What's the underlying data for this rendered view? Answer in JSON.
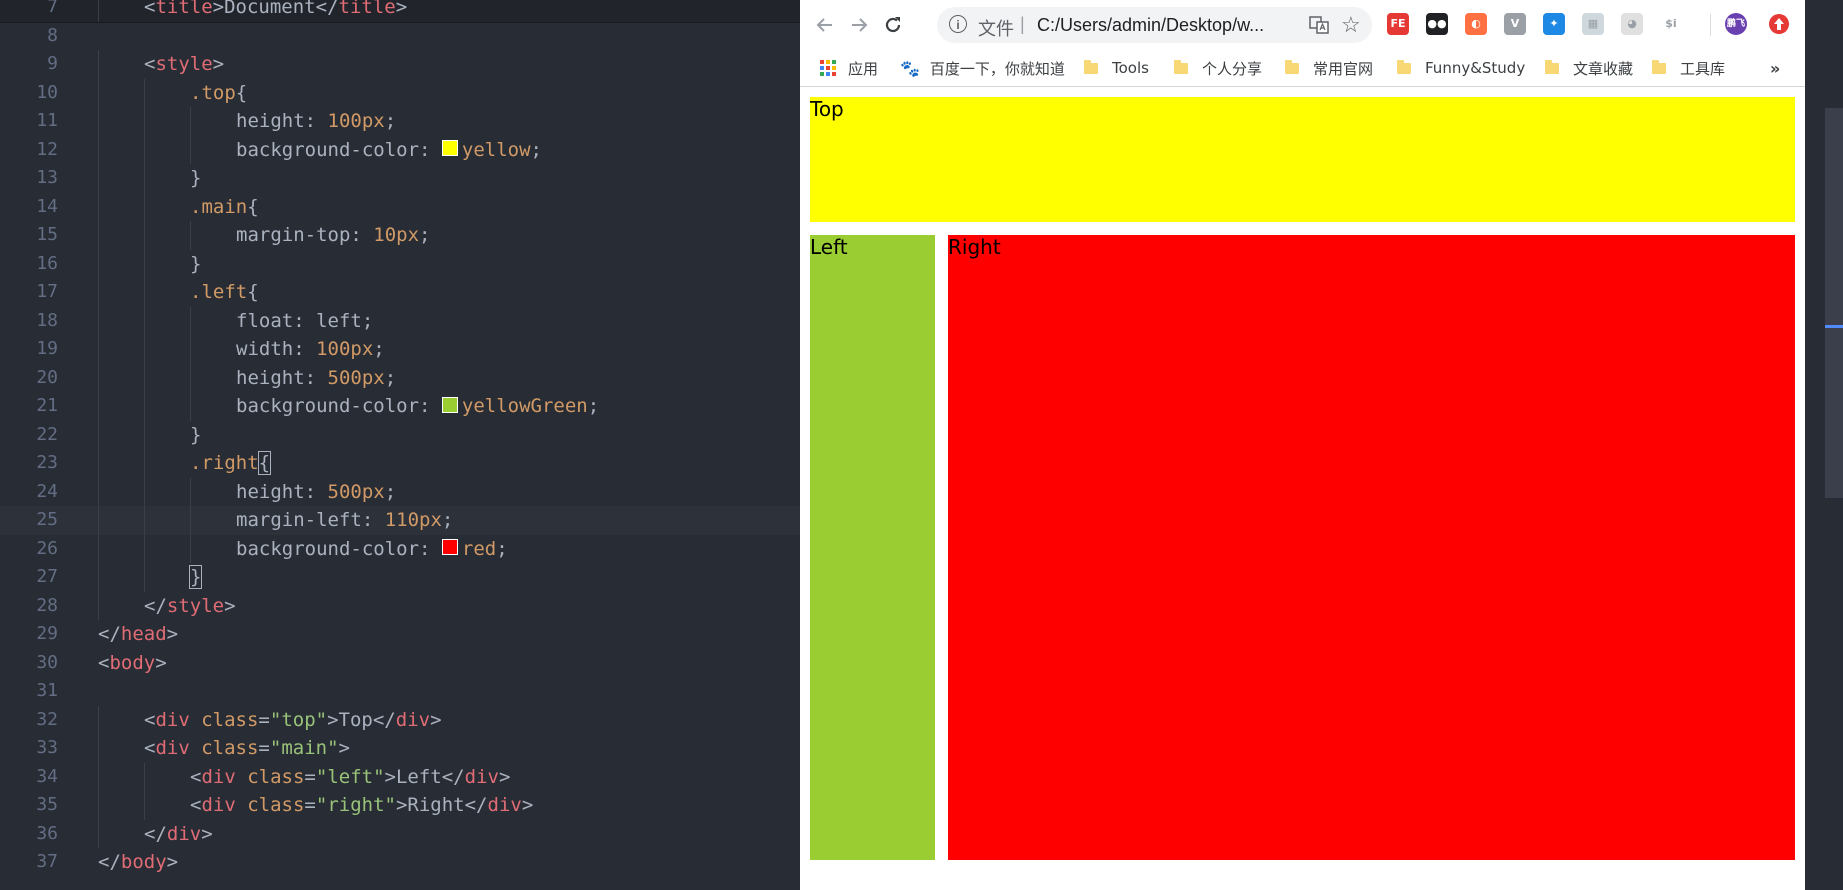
{
  "editor": {
    "lines": [
      {
        "n": "7",
        "indent": 1,
        "tokens": [
          [
            "t-punc",
            "<"
          ],
          [
            "t-tag",
            "title"
          ],
          [
            "t-punc",
            ">"
          ],
          [
            "t-text",
            "Document"
          ],
          [
            "t-punc",
            "</"
          ],
          [
            "t-tag",
            "title"
          ],
          [
            "t-punc",
            ">"
          ]
        ]
      },
      {
        "n": "8",
        "indent": 0,
        "tokens": []
      },
      {
        "n": "9",
        "indent": 1,
        "tokens": [
          [
            "t-punc",
            "<"
          ],
          [
            "t-tag",
            "style"
          ],
          [
            "t-punc",
            ">"
          ]
        ]
      },
      {
        "n": "10",
        "indent": 2,
        "tokens": [
          [
            "t-sel",
            ".top"
          ],
          [
            "t-punc",
            "{"
          ]
        ]
      },
      {
        "n": "11",
        "indent": 3,
        "tokens": [
          [
            "t-prop",
            "height: "
          ],
          [
            "t-num",
            "100px"
          ],
          [
            "t-punc",
            ";"
          ]
        ]
      },
      {
        "n": "12",
        "indent": 3,
        "tokens": [
          [
            "t-prop",
            "background-color: "
          ],
          [
            "swatch",
            "#ffff00"
          ],
          [
            "t-val",
            "yellow"
          ],
          [
            "t-punc",
            ";"
          ]
        ]
      },
      {
        "n": "13",
        "indent": 2,
        "tokens": [
          [
            "t-punc",
            "}"
          ]
        ]
      },
      {
        "n": "14",
        "indent": 2,
        "tokens": [
          [
            "t-sel",
            ".main"
          ],
          [
            "t-punc",
            "{"
          ]
        ]
      },
      {
        "n": "15",
        "indent": 3,
        "tokens": [
          [
            "t-prop",
            "margin-top: "
          ],
          [
            "t-num",
            "10px"
          ],
          [
            "t-punc",
            ";"
          ]
        ]
      },
      {
        "n": "16",
        "indent": 2,
        "tokens": [
          [
            "t-punc",
            "}"
          ]
        ]
      },
      {
        "n": "17",
        "indent": 2,
        "tokens": [
          [
            "t-sel",
            ".left"
          ],
          [
            "t-punc",
            "{"
          ]
        ]
      },
      {
        "n": "18",
        "indent": 3,
        "tokens": [
          [
            "t-prop",
            "float: left;"
          ]
        ]
      },
      {
        "n": "19",
        "indent": 3,
        "tokens": [
          [
            "t-prop",
            "width: "
          ],
          [
            "t-num",
            "100px"
          ],
          [
            "t-punc",
            ";"
          ]
        ]
      },
      {
        "n": "20",
        "indent": 3,
        "tokens": [
          [
            "t-prop",
            "height: "
          ],
          [
            "t-num",
            "500px"
          ],
          [
            "t-punc",
            ";"
          ]
        ]
      },
      {
        "n": "21",
        "indent": 3,
        "tokens": [
          [
            "t-prop",
            "background-color: "
          ],
          [
            "swatch",
            "#9acd32"
          ],
          [
            "t-val",
            "yellowGreen"
          ],
          [
            "t-punc",
            ";"
          ]
        ]
      },
      {
        "n": "22",
        "indent": 2,
        "tokens": [
          [
            "t-punc",
            "}"
          ]
        ]
      },
      {
        "n": "23",
        "indent": 2,
        "tokens": [
          [
            "t-sel",
            ".right"
          ],
          [
            "bracket",
            "{"
          ]
        ]
      },
      {
        "n": "24",
        "indent": 3,
        "tokens": [
          [
            "t-prop",
            "height: "
          ],
          [
            "t-num",
            "500px"
          ],
          [
            "t-punc",
            ";"
          ]
        ]
      },
      {
        "n": "25",
        "indent": 3,
        "active": true,
        "tokens": [
          [
            "t-prop",
            "margin-left: "
          ],
          [
            "t-num",
            "110px"
          ],
          [
            "t-punc",
            ";"
          ]
        ]
      },
      {
        "n": "26",
        "indent": 3,
        "tokens": [
          [
            "t-prop",
            "background-color: "
          ],
          [
            "swatch",
            "#ff0000"
          ],
          [
            "t-val",
            "red"
          ],
          [
            "t-punc",
            ";"
          ]
        ]
      },
      {
        "n": "27",
        "indent": 2,
        "tokens": [
          [
            "bracket",
            "}"
          ]
        ]
      },
      {
        "n": "28",
        "indent": 1,
        "tokens": [
          [
            "t-punc",
            "</"
          ],
          [
            "t-tag",
            "style"
          ],
          [
            "t-punc",
            ">"
          ]
        ]
      },
      {
        "n": "29",
        "indent": 0,
        "tokens": [
          [
            "t-punc",
            "</"
          ],
          [
            "t-tag",
            "head"
          ],
          [
            "t-punc",
            ">"
          ]
        ]
      },
      {
        "n": "30",
        "indent": 0,
        "tokens": [
          [
            "t-punc",
            "<"
          ],
          [
            "t-tag",
            "body"
          ],
          [
            "t-punc",
            ">"
          ]
        ]
      },
      {
        "n": "31",
        "indent": 0,
        "tokens": []
      },
      {
        "n": "32",
        "indent": 1,
        "tokens": [
          [
            "t-punc",
            "<"
          ],
          [
            "t-tag",
            "div"
          ],
          [
            "t-attr",
            " class"
          ],
          [
            "t-punc",
            "="
          ],
          [
            "t-str",
            "\"top\""
          ],
          [
            "t-punc",
            ">"
          ],
          [
            "t-text",
            "Top"
          ],
          [
            "t-punc",
            "</"
          ],
          [
            "t-tag",
            "div"
          ],
          [
            "t-punc",
            ">"
          ]
        ]
      },
      {
        "n": "33",
        "indent": 1,
        "tokens": [
          [
            "t-punc",
            "<"
          ],
          [
            "t-tag",
            "div"
          ],
          [
            "t-attr",
            " class"
          ],
          [
            "t-punc",
            "="
          ],
          [
            "t-str",
            "\"main\""
          ],
          [
            "t-punc",
            ">"
          ]
        ]
      },
      {
        "n": "34",
        "indent": 2,
        "tokens": [
          [
            "t-punc",
            "<"
          ],
          [
            "t-tag",
            "div"
          ],
          [
            "t-attr",
            " class"
          ],
          [
            "t-punc",
            "="
          ],
          [
            "t-str",
            "\"left\""
          ],
          [
            "t-punc",
            ">"
          ],
          [
            "t-text",
            "Left"
          ],
          [
            "t-punc",
            "</"
          ],
          [
            "t-tag",
            "div"
          ],
          [
            "t-punc",
            ">"
          ]
        ]
      },
      {
        "n": "35",
        "indent": 2,
        "tokens": [
          [
            "t-punc",
            "<"
          ],
          [
            "t-tag",
            "div"
          ],
          [
            "t-attr",
            " class"
          ],
          [
            "t-punc",
            "="
          ],
          [
            "t-str",
            "\"right\""
          ],
          [
            "t-punc",
            ">"
          ],
          [
            "t-text",
            "Right"
          ],
          [
            "t-punc",
            "</"
          ],
          [
            "t-tag",
            "div"
          ],
          [
            "t-punc",
            ">"
          ]
        ]
      },
      {
        "n": "36",
        "indent": 1,
        "tokens": [
          [
            "t-punc",
            "</"
          ],
          [
            "t-tag",
            "div"
          ],
          [
            "t-punc",
            ">"
          ]
        ]
      },
      {
        "n": "37",
        "indent": 0,
        "tokens": [
          [
            "t-punc",
            "</"
          ],
          [
            "t-tag",
            "body"
          ],
          [
            "t-punc",
            ">"
          ]
        ]
      }
    ]
  },
  "browser": {
    "back_icon": "arrow-left-icon",
    "forward_icon": "arrow-right-icon",
    "reload_icon": "reload-icon",
    "omnibox": {
      "scheme_label": "文件",
      "separator": "|",
      "url": "C:/Users/admin/Desktop/w..."
    },
    "extensions": [
      {
        "name": "fe-extension-icon",
        "label": "FE",
        "color": "#e53935"
      },
      {
        "name": "tampermonkey-icon",
        "label": "●●",
        "color": "#202124"
      },
      {
        "name": "firefox-like-icon",
        "label": "◐",
        "color": "#ff7043"
      },
      {
        "name": "vue-devtools-icon",
        "label": "V",
        "color": "#9aa0a6"
      },
      {
        "name": "blue-circle-extension-icon",
        "label": "✦",
        "color": "#1e88e5"
      },
      {
        "name": "gray-extension-icon",
        "label": "▦",
        "color": "#cfd8dc"
      },
      {
        "name": "panda-extension-icon",
        "label": "◕",
        "color": "#e0e0e0"
      },
      {
        "name": "dollar-i-extension-icon",
        "label": "$i",
        "color": "#ffffff"
      }
    ],
    "profile": {
      "label": "鹏飞",
      "color": "#6a3fb0"
    },
    "update_icon_color": "#e53935",
    "bookmarks": [
      {
        "name": "bookmark-apps",
        "label": "应用",
        "kind": "apps"
      },
      {
        "name": "bookmark-baidu",
        "label": "百度一下，你就知道",
        "kind": "paw"
      },
      {
        "name": "bookmark-tools",
        "label": "Tools",
        "kind": "folder"
      },
      {
        "name": "bookmark-personal-share",
        "label": "个人分享",
        "kind": "folder"
      },
      {
        "name": "bookmark-official-sites",
        "label": "常用官网",
        "kind": "folder"
      },
      {
        "name": "bookmark-funny-study",
        "label": "Funny&Study",
        "kind": "folder"
      },
      {
        "name": "bookmark-article-favorites",
        "label": "文章收藏",
        "kind": "folder"
      },
      {
        "name": "bookmark-toolbox",
        "label": "工具库",
        "kind": "folder"
      }
    ],
    "more_bookmarks": "»"
  },
  "page": {
    "top": {
      "label": "Top",
      "color": "#ffff00"
    },
    "left": {
      "label": "Left",
      "color": "#9acd32"
    },
    "right": {
      "label": "Right",
      "color": "#ff0000"
    }
  }
}
